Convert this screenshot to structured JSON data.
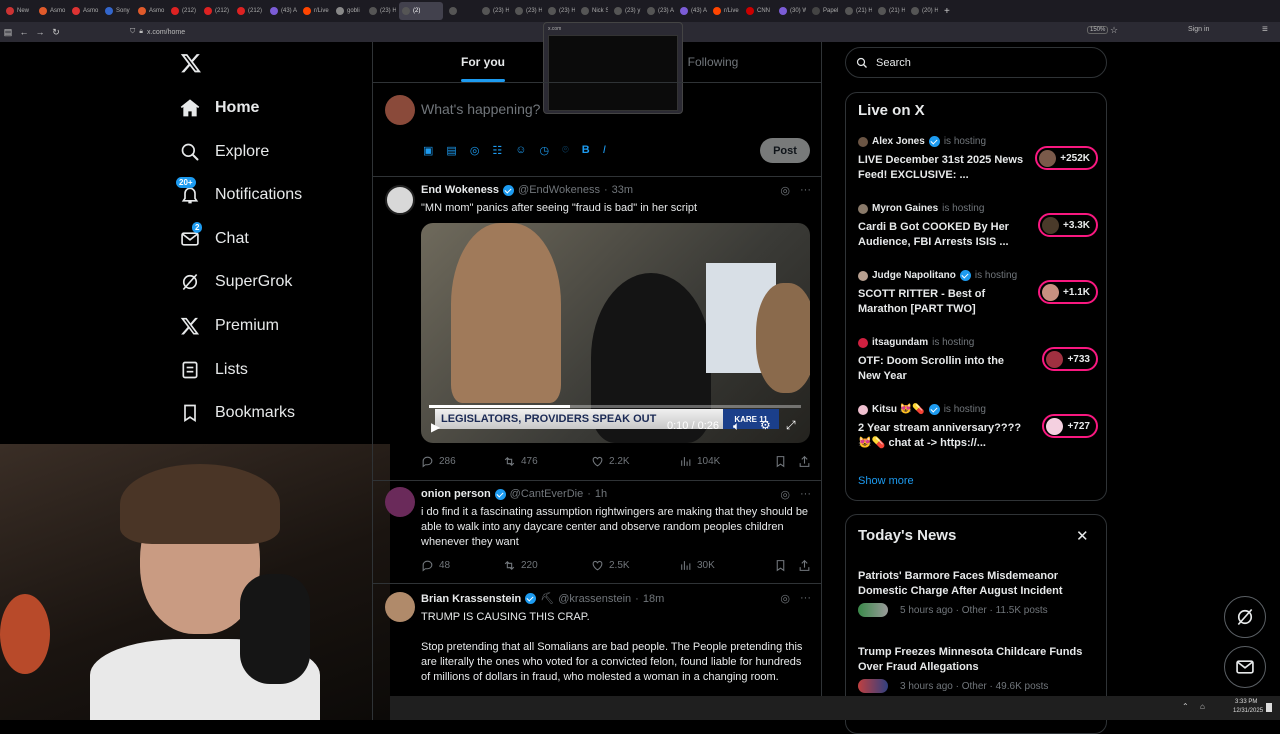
{
  "browser": {
    "tabs": [
      "New",
      "Asmo",
      "Asmo",
      "Sony",
      "Asmo",
      "(212)",
      "(212)",
      "(212)",
      "(43) A",
      "r/Live",
      "gobli",
      "(23) H",
      "(2)",
      "",
      "(23) H",
      "(23) H",
      "(23) H",
      "Nick S",
      "(23) y",
      "(23) A",
      "(43) A",
      "r/Live",
      "CNN",
      "(30) W",
      "Papel",
      "(21) H",
      "(21) H",
      "(20) H"
    ],
    "active_tab": 12,
    "url": "x.com/home",
    "zoom": "150%",
    "sign_in": "Sign in",
    "hover_preview_url": "x.com"
  },
  "sidebar": {
    "items": [
      {
        "label": "Home",
        "icon": "home-icon"
      },
      {
        "label": "Explore",
        "icon": "search-icon"
      },
      {
        "label": "Notifications",
        "icon": "bell-icon",
        "badge": "20+"
      },
      {
        "label": "Chat",
        "icon": "mail-icon",
        "badge": "2"
      },
      {
        "label": "SuperGrok",
        "icon": "grok-icon"
      },
      {
        "label": "Premium",
        "icon": "x-logo-icon"
      },
      {
        "label": "Lists",
        "icon": "list-icon"
      },
      {
        "label": "Bookmarks",
        "icon": "bookmark-icon"
      }
    ]
  },
  "timeline": {
    "tabs": [
      "For you",
      "Following"
    ],
    "composer_placeholder": "What's happening?",
    "post_button": "Post",
    "posts": [
      {
        "name": "End Wokeness",
        "handle": "@EndWokeness",
        "time": "33m",
        "text": "\"MN mom\" panics after seeing \"fraud is bad\" in her script",
        "video_caption": "LEGISLATORS, PROVIDERS SPEAK OUT",
        "video_time": "0:10 / 0:26",
        "video_logo": "KARE 11",
        "replies": "286",
        "reposts": "476",
        "likes": "2.2K",
        "views": "104K"
      },
      {
        "name": "onion person",
        "handle": "@CantEverDie",
        "time": "1h",
        "text": "i do find it a fascinating assumption rightwingers are making that they should be able to walk into any daycare center and observe random peoples children whenever they want",
        "replies": "48",
        "reposts": "220",
        "likes": "2.5K",
        "views": "30K"
      },
      {
        "name": "Brian Krassenstein",
        "handle": "@krassenstein",
        "time": "18m",
        "text1": "TRUMP IS CAUSING THIS CRAP.",
        "text2": "Stop pretending that all Somalians are bad people.  The People pretending this are literally the ones who voted for a convicted felon, found liable for hundreds of millions of dollars in fraud, who molested a woman in a changing room."
      }
    ]
  },
  "right": {
    "search_placeholder": "Search",
    "live_title": "Live on X",
    "is_hosting": "is hosting",
    "live": [
      {
        "host": "Alex Jones",
        "title": "LIVE December 31st 2025 News Feed! EXCLUSIVE: ...",
        "count": "+252K"
      },
      {
        "host": "Myron Gaines",
        "title": "Cardi B Got COOKED By Her Audience, FBI Arrests ISIS ...",
        "count": "+3.3K"
      },
      {
        "host": "Judge Napolitano",
        "title": "SCOTT RITTER -  Best of Marathon  [PART TWO]",
        "count": "+1.1K"
      },
      {
        "host": "itsagundam",
        "title": "OTF: Doom Scrollin into the New Year",
        "count": "+733"
      },
      {
        "host": "Kitsu 😻💊",
        "title": "2 Year stream anniversary???? 😻💊  chat at -> https://...",
        "count": "+727"
      }
    ],
    "show_more": "Show more",
    "news_title": "Today's News",
    "news": [
      {
        "title": "Patriots' Barmore Faces Misdemeanor Domestic Charge After August Incident",
        "meta": "5 hours ago · Other · 11.5K posts"
      },
      {
        "title": "Trump Freezes Minnesota Childcare Funds Over Fraud Allegations",
        "meta": "3 hours ago · Other · 49.6K posts"
      }
    ]
  },
  "taskbar": {
    "time": "3:33 PM",
    "date": "12/31/2025"
  },
  "colors": {
    "accent": "#1d9bf0",
    "live": "#f91880",
    "bg": "#000000",
    "border": "#2f3336",
    "muted": "#71767b"
  }
}
